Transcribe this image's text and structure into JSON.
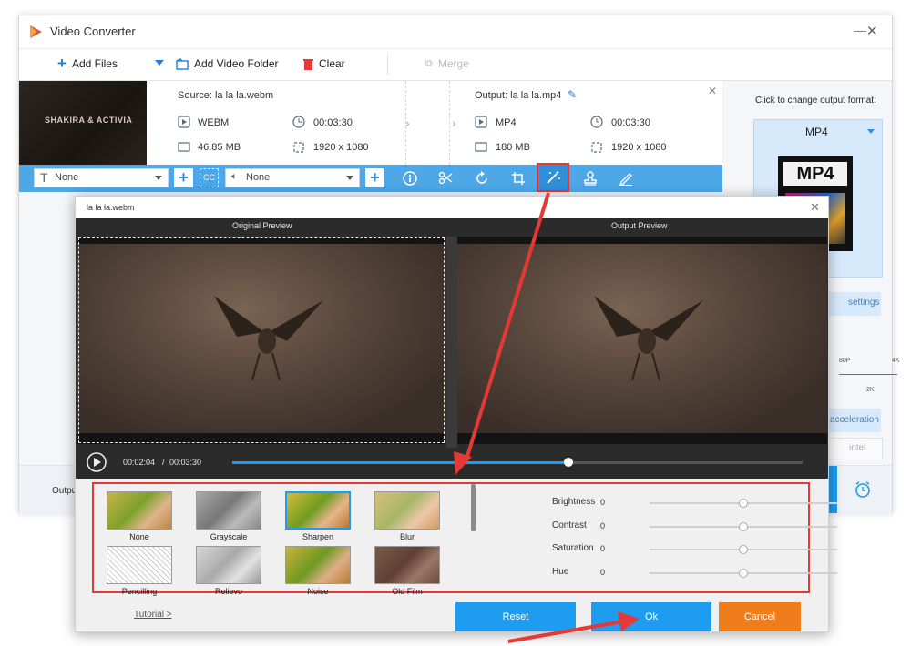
{
  "app": {
    "title": "Video Converter"
  },
  "toolbar": {
    "add_files": "Add Files",
    "add_folder": "Add Video Folder",
    "clear": "Clear",
    "merge": "Merge"
  },
  "file": {
    "thumb_text": "SHAKIRA & ACTIVIA",
    "source_label": "Source: la la la.webm",
    "output_label": "Output: la la la.mp4",
    "src_format": "WEBM",
    "src_duration": "00:03:30",
    "src_size": "46.85 MB",
    "src_res": "1920 x 1080",
    "out_format": "MP4",
    "out_duration": "00:03:30",
    "out_size": "180 MB",
    "out_res": "1920 x 1080"
  },
  "editbar": {
    "subtitle_select": "None",
    "audio_select": "None"
  },
  "right_panel": {
    "prompt": "Click to change output format:",
    "format": "MP4",
    "format_badge": "MP4",
    "settings": "settings",
    "res_labels": [
      "80P",
      "4K",
      "2K"
    ],
    "hw_accel": "acceleration",
    "intel": "intel"
  },
  "main_bottom": {
    "output_label": "Outpu"
  },
  "dialog": {
    "title": "la la la.webm",
    "original_preview": "Original Preview",
    "output_preview": "Output Preview",
    "time_current": "00:02:04",
    "time_sep": "/",
    "time_total": "00:03:30",
    "progress": 0.59,
    "filters": [
      {
        "name": "None"
      },
      {
        "name": "Grayscale"
      },
      {
        "name": "Sharpen"
      },
      {
        "name": "Blur"
      },
      {
        "name": "Pencilling"
      },
      {
        "name": "Relievo"
      },
      {
        "name": "Noise"
      },
      {
        "name": "Old Film"
      }
    ],
    "selected_filter": "Sharpen",
    "sliders": [
      {
        "label": "Brightness",
        "value": "0",
        "level": 0.5
      },
      {
        "label": "Contrast",
        "value": "0",
        "level": 0.5
      },
      {
        "label": "Saturation",
        "value": "0",
        "level": 0.5
      },
      {
        "label": "Hue",
        "value": "0",
        "level": 0.5
      }
    ],
    "tutorial": "Tutorial >",
    "reset": "Reset",
    "ok": "Ok",
    "cancel": "Cancel"
  },
  "colors": {
    "accent": "#1e9cf0",
    "highlight": "#e53935",
    "orange": "#f07d1c"
  }
}
